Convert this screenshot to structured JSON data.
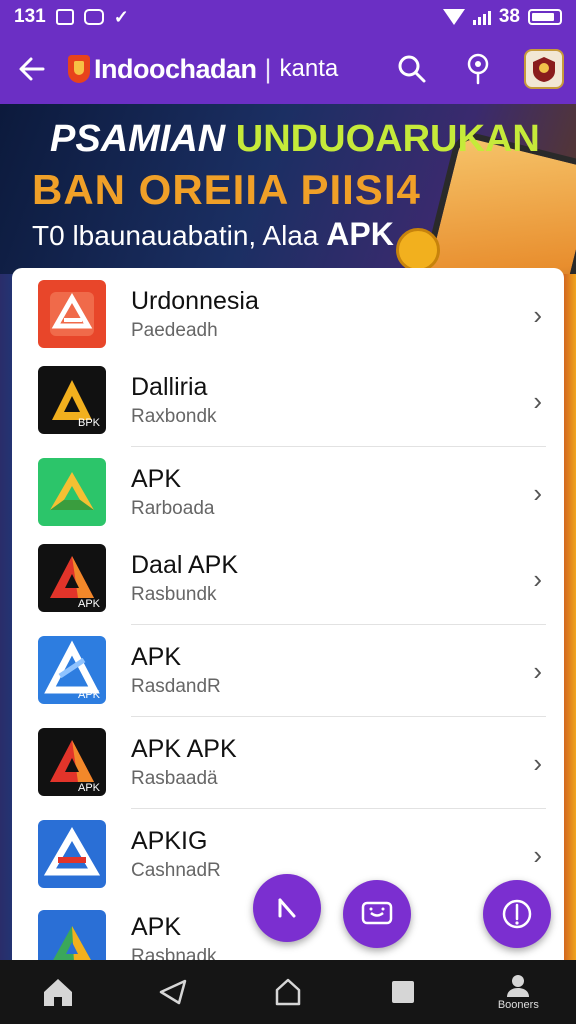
{
  "status_bar": {
    "time": "131",
    "battery": "38"
  },
  "app_bar": {
    "title": "Indoochadan",
    "separator": "|",
    "subtitle": "kanta",
    "icons": [
      "back-arrow-icon",
      "search-icon",
      "location-pin-icon",
      "avatar"
    ]
  },
  "banner": {
    "line1_white": "PSAMIAN",
    "line1_green": "UNDUOARUKAN",
    "line2": "BAN OREIIA PIISI4",
    "line3_text": "T0 lbaunauabatin, Alaa",
    "line3_bold": "APK"
  },
  "apps": [
    {
      "name": "Urdonnesia",
      "sub": "Paedeadh",
      "icon_label": ""
    },
    {
      "name": "Dalliria",
      "sub": "Raxbondk",
      "icon_label": "BPK"
    },
    {
      "name": "APK",
      "sub": "Rarboada",
      "icon_label": ""
    },
    {
      "name": "Daal APK",
      "sub": "Rasbundk",
      "icon_label": "APK"
    },
    {
      "name": "APK",
      "sub": "RasdandR",
      "icon_label": "APK"
    },
    {
      "name": "APK APK",
      "sub": "Rasbaadä",
      "icon_label": "APK"
    },
    {
      "name": "APKIG",
      "sub": "CashnadR",
      "icon_label": ""
    },
    {
      "name": "APK",
      "sub": "Rasbnadk",
      "icon_label": ""
    }
  ],
  "bottom_nav": {
    "profile_label": "Booners"
  },
  "colors": {
    "primary": "#6b2fc4",
    "fab": "#7b2fd0",
    "banner_green": "#c6ea3a",
    "banner_orange": "#f0a028"
  }
}
